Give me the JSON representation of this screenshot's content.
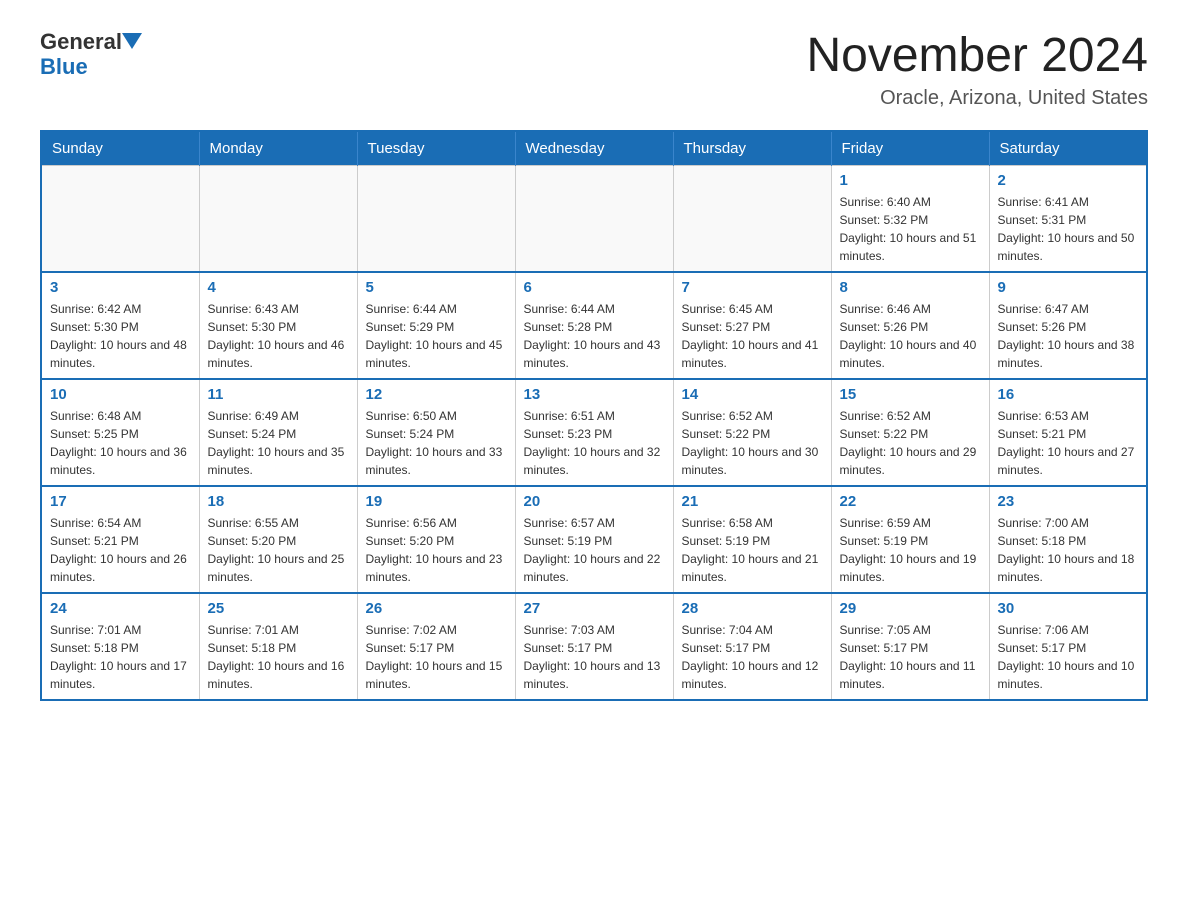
{
  "header": {
    "logo_general": "General",
    "logo_blue": "Blue",
    "month_year": "November 2024",
    "location": "Oracle, Arizona, United States"
  },
  "days_of_week": [
    "Sunday",
    "Monday",
    "Tuesday",
    "Wednesday",
    "Thursday",
    "Friday",
    "Saturday"
  ],
  "weeks": [
    [
      {
        "day": "",
        "sunrise": "",
        "sunset": "",
        "daylight": "",
        "empty": true
      },
      {
        "day": "",
        "sunrise": "",
        "sunset": "",
        "daylight": "",
        "empty": true
      },
      {
        "day": "",
        "sunrise": "",
        "sunset": "",
        "daylight": "",
        "empty": true
      },
      {
        "day": "",
        "sunrise": "",
        "sunset": "",
        "daylight": "",
        "empty": true
      },
      {
        "day": "",
        "sunrise": "",
        "sunset": "",
        "daylight": "",
        "empty": true
      },
      {
        "day": "1",
        "sunrise": "Sunrise: 6:40 AM",
        "sunset": "Sunset: 5:32 PM",
        "daylight": "Daylight: 10 hours and 51 minutes.",
        "empty": false
      },
      {
        "day": "2",
        "sunrise": "Sunrise: 6:41 AM",
        "sunset": "Sunset: 5:31 PM",
        "daylight": "Daylight: 10 hours and 50 minutes.",
        "empty": false
      }
    ],
    [
      {
        "day": "3",
        "sunrise": "Sunrise: 6:42 AM",
        "sunset": "Sunset: 5:30 PM",
        "daylight": "Daylight: 10 hours and 48 minutes.",
        "empty": false
      },
      {
        "day": "4",
        "sunrise": "Sunrise: 6:43 AM",
        "sunset": "Sunset: 5:30 PM",
        "daylight": "Daylight: 10 hours and 46 minutes.",
        "empty": false
      },
      {
        "day": "5",
        "sunrise": "Sunrise: 6:44 AM",
        "sunset": "Sunset: 5:29 PM",
        "daylight": "Daylight: 10 hours and 45 minutes.",
        "empty": false
      },
      {
        "day": "6",
        "sunrise": "Sunrise: 6:44 AM",
        "sunset": "Sunset: 5:28 PM",
        "daylight": "Daylight: 10 hours and 43 minutes.",
        "empty": false
      },
      {
        "day": "7",
        "sunrise": "Sunrise: 6:45 AM",
        "sunset": "Sunset: 5:27 PM",
        "daylight": "Daylight: 10 hours and 41 minutes.",
        "empty": false
      },
      {
        "day": "8",
        "sunrise": "Sunrise: 6:46 AM",
        "sunset": "Sunset: 5:26 PM",
        "daylight": "Daylight: 10 hours and 40 minutes.",
        "empty": false
      },
      {
        "day": "9",
        "sunrise": "Sunrise: 6:47 AM",
        "sunset": "Sunset: 5:26 PM",
        "daylight": "Daylight: 10 hours and 38 minutes.",
        "empty": false
      }
    ],
    [
      {
        "day": "10",
        "sunrise": "Sunrise: 6:48 AM",
        "sunset": "Sunset: 5:25 PM",
        "daylight": "Daylight: 10 hours and 36 minutes.",
        "empty": false
      },
      {
        "day": "11",
        "sunrise": "Sunrise: 6:49 AM",
        "sunset": "Sunset: 5:24 PM",
        "daylight": "Daylight: 10 hours and 35 minutes.",
        "empty": false
      },
      {
        "day": "12",
        "sunrise": "Sunrise: 6:50 AM",
        "sunset": "Sunset: 5:24 PM",
        "daylight": "Daylight: 10 hours and 33 minutes.",
        "empty": false
      },
      {
        "day": "13",
        "sunrise": "Sunrise: 6:51 AM",
        "sunset": "Sunset: 5:23 PM",
        "daylight": "Daylight: 10 hours and 32 minutes.",
        "empty": false
      },
      {
        "day": "14",
        "sunrise": "Sunrise: 6:52 AM",
        "sunset": "Sunset: 5:22 PM",
        "daylight": "Daylight: 10 hours and 30 minutes.",
        "empty": false
      },
      {
        "day": "15",
        "sunrise": "Sunrise: 6:52 AM",
        "sunset": "Sunset: 5:22 PM",
        "daylight": "Daylight: 10 hours and 29 minutes.",
        "empty": false
      },
      {
        "day": "16",
        "sunrise": "Sunrise: 6:53 AM",
        "sunset": "Sunset: 5:21 PM",
        "daylight": "Daylight: 10 hours and 27 minutes.",
        "empty": false
      }
    ],
    [
      {
        "day": "17",
        "sunrise": "Sunrise: 6:54 AM",
        "sunset": "Sunset: 5:21 PM",
        "daylight": "Daylight: 10 hours and 26 minutes.",
        "empty": false
      },
      {
        "day": "18",
        "sunrise": "Sunrise: 6:55 AM",
        "sunset": "Sunset: 5:20 PM",
        "daylight": "Daylight: 10 hours and 25 minutes.",
        "empty": false
      },
      {
        "day": "19",
        "sunrise": "Sunrise: 6:56 AM",
        "sunset": "Sunset: 5:20 PM",
        "daylight": "Daylight: 10 hours and 23 minutes.",
        "empty": false
      },
      {
        "day": "20",
        "sunrise": "Sunrise: 6:57 AM",
        "sunset": "Sunset: 5:19 PM",
        "daylight": "Daylight: 10 hours and 22 minutes.",
        "empty": false
      },
      {
        "day": "21",
        "sunrise": "Sunrise: 6:58 AM",
        "sunset": "Sunset: 5:19 PM",
        "daylight": "Daylight: 10 hours and 21 minutes.",
        "empty": false
      },
      {
        "day": "22",
        "sunrise": "Sunrise: 6:59 AM",
        "sunset": "Sunset: 5:19 PM",
        "daylight": "Daylight: 10 hours and 19 minutes.",
        "empty": false
      },
      {
        "day": "23",
        "sunrise": "Sunrise: 7:00 AM",
        "sunset": "Sunset: 5:18 PM",
        "daylight": "Daylight: 10 hours and 18 minutes.",
        "empty": false
      }
    ],
    [
      {
        "day": "24",
        "sunrise": "Sunrise: 7:01 AM",
        "sunset": "Sunset: 5:18 PM",
        "daylight": "Daylight: 10 hours and 17 minutes.",
        "empty": false
      },
      {
        "day": "25",
        "sunrise": "Sunrise: 7:01 AM",
        "sunset": "Sunset: 5:18 PM",
        "daylight": "Daylight: 10 hours and 16 minutes.",
        "empty": false
      },
      {
        "day": "26",
        "sunrise": "Sunrise: 7:02 AM",
        "sunset": "Sunset: 5:17 PM",
        "daylight": "Daylight: 10 hours and 15 minutes.",
        "empty": false
      },
      {
        "day": "27",
        "sunrise": "Sunrise: 7:03 AM",
        "sunset": "Sunset: 5:17 PM",
        "daylight": "Daylight: 10 hours and 13 minutes.",
        "empty": false
      },
      {
        "day": "28",
        "sunrise": "Sunrise: 7:04 AM",
        "sunset": "Sunset: 5:17 PM",
        "daylight": "Daylight: 10 hours and 12 minutes.",
        "empty": false
      },
      {
        "day": "29",
        "sunrise": "Sunrise: 7:05 AM",
        "sunset": "Sunset: 5:17 PM",
        "daylight": "Daylight: 10 hours and 11 minutes.",
        "empty": false
      },
      {
        "day": "30",
        "sunrise": "Sunrise: 7:06 AM",
        "sunset": "Sunset: 5:17 PM",
        "daylight": "Daylight: 10 hours and 10 minutes.",
        "empty": false
      }
    ]
  ]
}
